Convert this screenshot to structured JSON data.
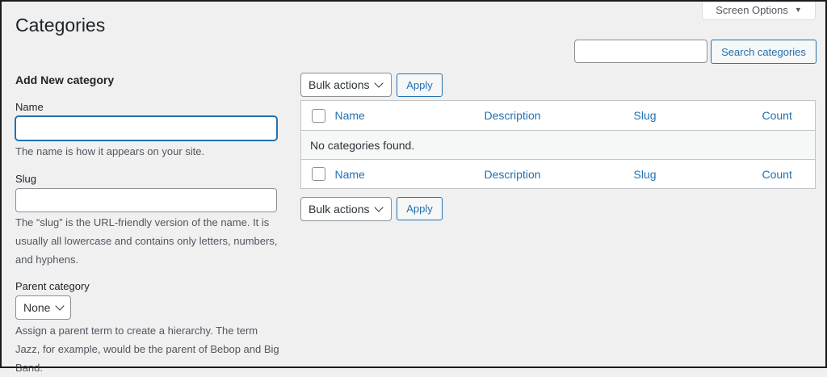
{
  "header": {
    "screen_options": "Screen Options",
    "title": "Categories"
  },
  "search": {
    "button_label": "Search categories",
    "value": ""
  },
  "form": {
    "title": "Add New category",
    "name_label": "Name",
    "name_value": "",
    "name_description": "The name is how it appears on your site.",
    "slug_label": "Slug",
    "slug_value": "",
    "slug_description": "The “slug” is the URL-friendly version of the name. It is usually all lowercase and contains only letters, numbers, and hyphens.",
    "parent_label": "Parent category",
    "parent_selected": "None",
    "parent_description": "Assign a parent term to create a hierarchy. The term Jazz, for example, would be the parent of Bebop and Big Band."
  },
  "bulk": {
    "top_label": "Bulk actions",
    "top_apply": "Apply",
    "bottom_label": "Bulk actions",
    "bottom_apply": "Apply"
  },
  "table": {
    "columns": [
      "Name",
      "Description",
      "Slug",
      "Count"
    ],
    "empty_message": "No categories found."
  },
  "colors": {
    "accent": "#2271b1",
    "background": "#f0f0f1"
  }
}
